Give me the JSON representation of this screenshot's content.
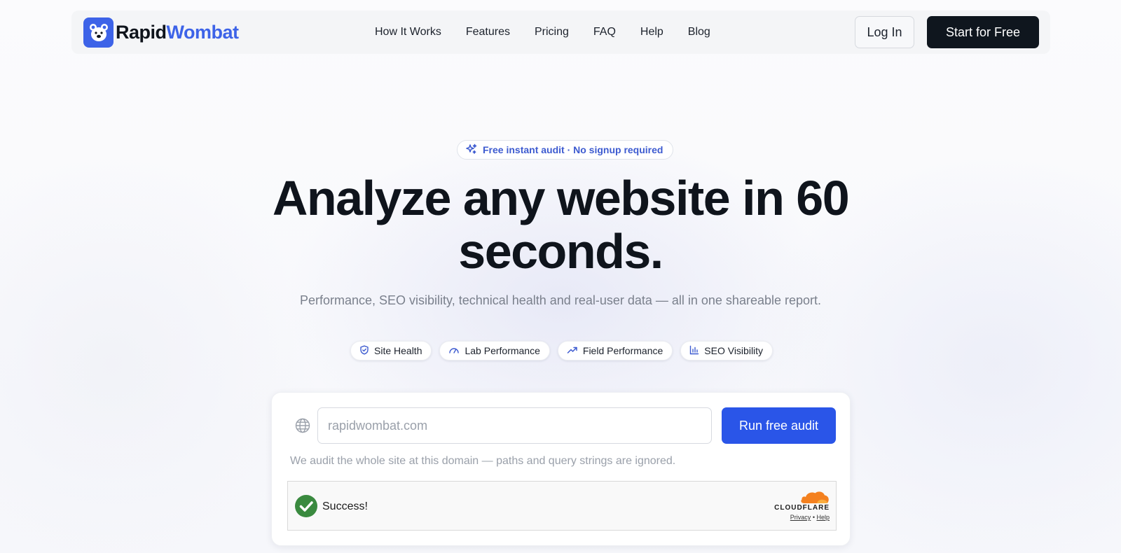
{
  "brand": {
    "name_part1": "Rapid",
    "name_part2": "Wombat",
    "accent_color": "#3d63e8"
  },
  "nav": {
    "items": [
      "How It Works",
      "Features",
      "Pricing",
      "FAQ",
      "Help",
      "Blog"
    ]
  },
  "header": {
    "login_label": "Log In",
    "start_label": "Start for Free"
  },
  "hero": {
    "badge": "Free instant audit · No signup required",
    "title_line1": "Analyze any website in 60",
    "title_line2": "seconds.",
    "subtitle": "Performance, SEO visibility, technical health and real-user data — all in one shareable report.",
    "pills": [
      {
        "label": "Site Health",
        "icon": "shield-icon"
      },
      {
        "label": "Lab Performance",
        "icon": "gauge-icon"
      },
      {
        "label": "Field Performance",
        "icon": "trending-up-icon"
      },
      {
        "label": "SEO Visibility",
        "icon": "bar-chart-icon"
      }
    ]
  },
  "audit": {
    "url_placeholder": "rapidwombat.com",
    "url_value": "",
    "run_label": "Run free audit",
    "hint": "We audit the whole site at this domain — paths and query strings are ignored.",
    "button_color": "#2a55e8"
  },
  "captcha": {
    "status": "Success!",
    "provider": "CLOUDFLARE",
    "privacy_label": "Privacy",
    "separator": "•",
    "help_label": "Help",
    "success_color": "#3a8a3f"
  }
}
